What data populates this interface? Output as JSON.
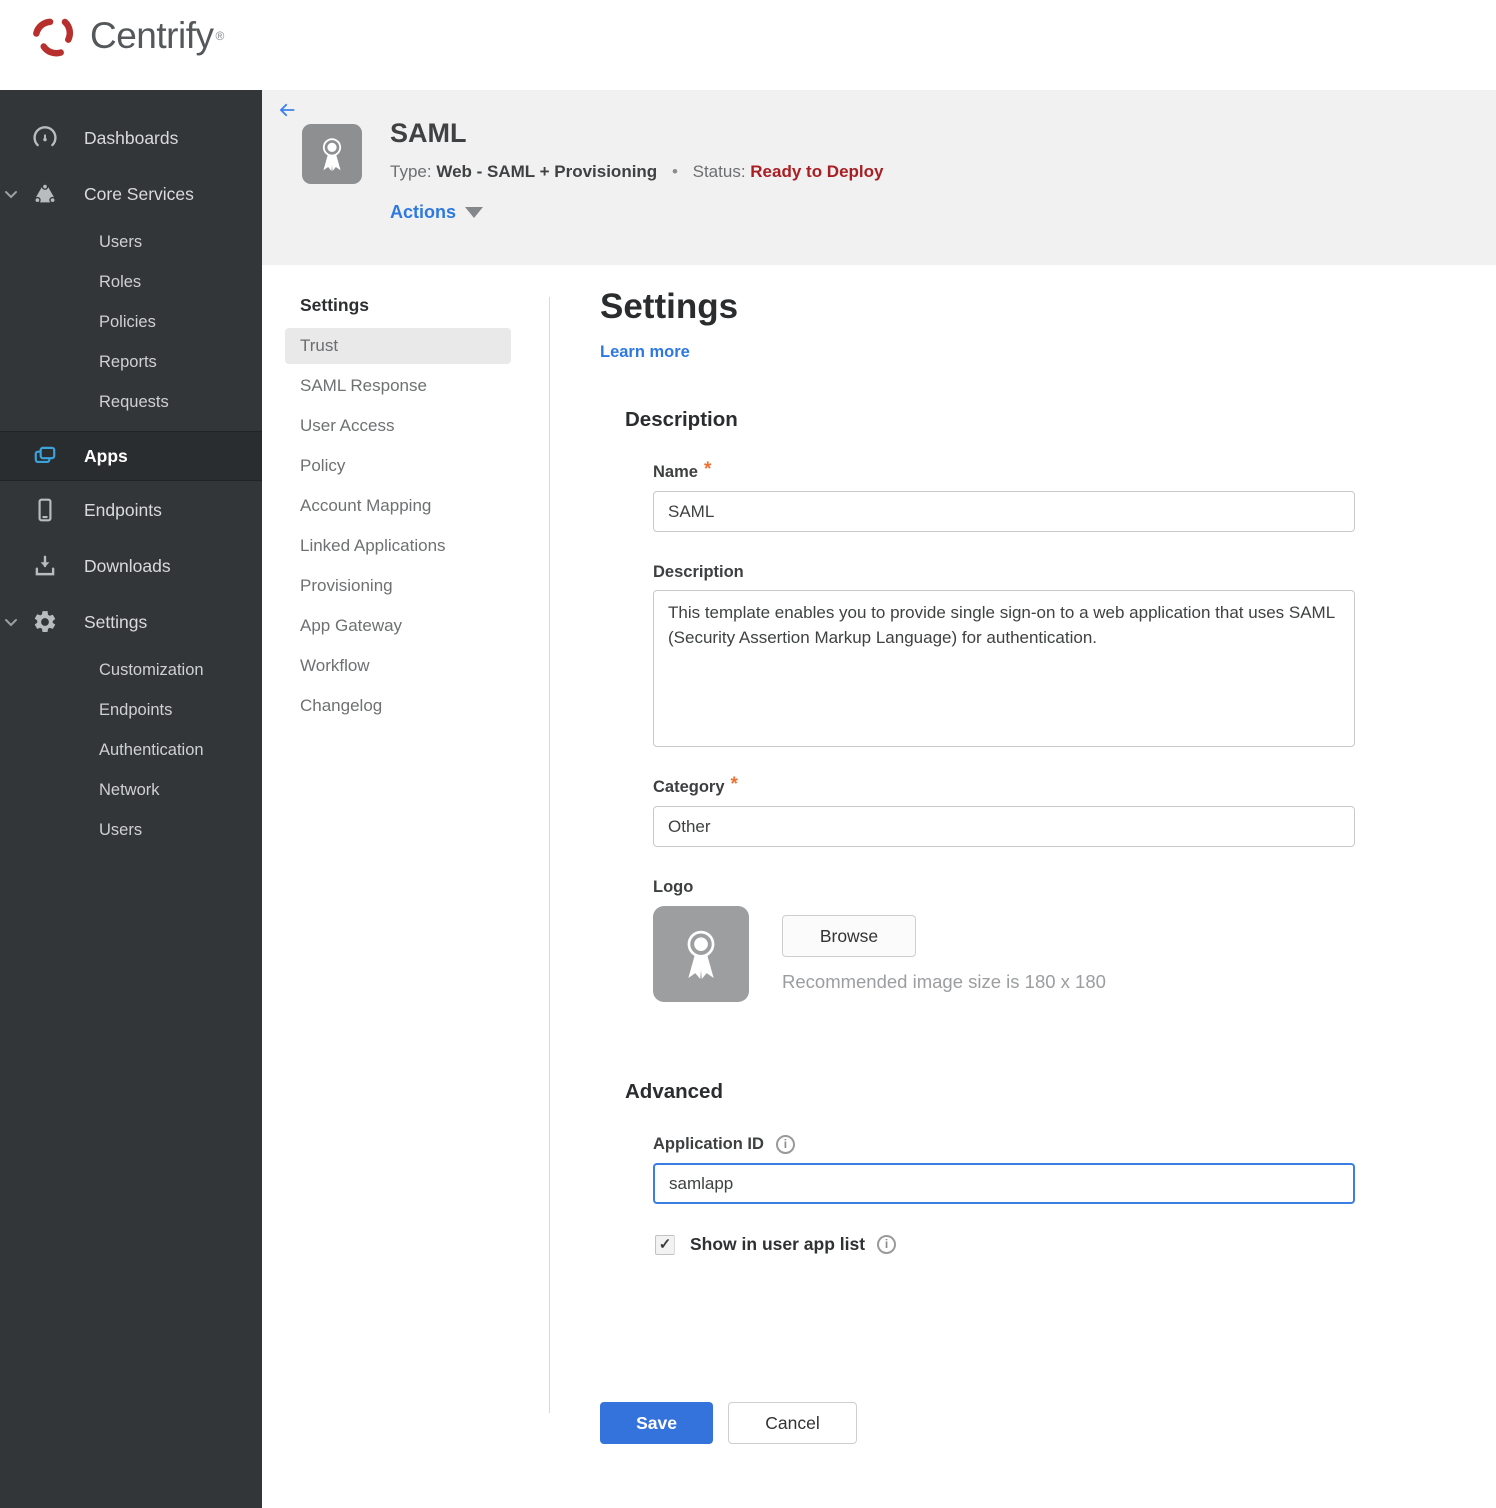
{
  "brand": {
    "name": "Centrify",
    "mark": "®"
  },
  "colors": {
    "accent_blue": "#2e79e0",
    "save_blue": "#3473dc",
    "apps_icon_blue": "#3ba3dc",
    "status_red": "#a81e23",
    "required_orange": "#ed7133",
    "sidebar_bg": "#333639"
  },
  "icons": {
    "info_glyph": "i",
    "check_glyph": "✓"
  },
  "sidebar": {
    "items": [
      {
        "label": "Dashboards",
        "icon": "gauge-icon",
        "level": "top"
      },
      {
        "label": "Core Services",
        "icon": "core-services-icon",
        "level": "top",
        "expanded": true
      },
      {
        "label": "Users",
        "level": "sub"
      },
      {
        "label": "Roles",
        "level": "sub"
      },
      {
        "label": "Policies",
        "level": "sub"
      },
      {
        "label": "Reports",
        "level": "sub"
      },
      {
        "label": "Requests",
        "level": "sub"
      },
      {
        "label": "Apps",
        "icon": "apps-icon",
        "level": "top",
        "active": true
      },
      {
        "label": "Endpoints",
        "icon": "endpoint-icon",
        "level": "top"
      },
      {
        "label": "Downloads",
        "icon": "download-icon",
        "level": "top"
      },
      {
        "label": "Settings",
        "icon": "gear-icon",
        "level": "top",
        "expanded": true
      },
      {
        "label": "Customization",
        "level": "sub"
      },
      {
        "label": "Endpoints",
        "level": "sub"
      },
      {
        "label": "Authentication",
        "level": "sub"
      },
      {
        "label": "Network",
        "level": "sub"
      },
      {
        "label": "Users",
        "level": "sub"
      }
    ]
  },
  "app_header": {
    "title": "SAML",
    "type_label": "Type:",
    "type_value": "Web - SAML + Provisioning",
    "separator": "•",
    "status_label": "Status:",
    "status_value": "Ready to Deploy",
    "actions_label": "Actions"
  },
  "subnav": {
    "header": "Settings",
    "items": [
      {
        "label": "Trust",
        "active": true
      },
      {
        "label": "SAML Response"
      },
      {
        "label": "User Access"
      },
      {
        "label": "Policy"
      },
      {
        "label": "Account Mapping"
      },
      {
        "label": "Linked Applications"
      },
      {
        "label": "Provisioning"
      },
      {
        "label": "App Gateway"
      },
      {
        "label": "Workflow"
      },
      {
        "label": "Changelog"
      }
    ]
  },
  "main": {
    "title": "Settings",
    "learn_more": "Learn more",
    "required_mark": "*",
    "description_section": {
      "heading": "Description",
      "name_label": "Name",
      "name_value": "SAML",
      "description_label": "Description",
      "description_value": "This template enables you to provide single sign-on to a web application that uses SAML (Security Assertion Markup Language) for authentication.",
      "category_label": "Category",
      "category_value": "Other",
      "logo_label": "Logo",
      "browse_label": "Browse",
      "logo_hint": "Recommended image size is 180 x 180"
    },
    "advanced_section": {
      "heading": "Advanced",
      "app_id_label": "Application ID",
      "app_id_value": "samlapp",
      "show_in_list_label": "Show in user app list",
      "checkbox_checked": true
    },
    "footer": {
      "save_label": "Save",
      "cancel_label": "Cancel"
    }
  }
}
